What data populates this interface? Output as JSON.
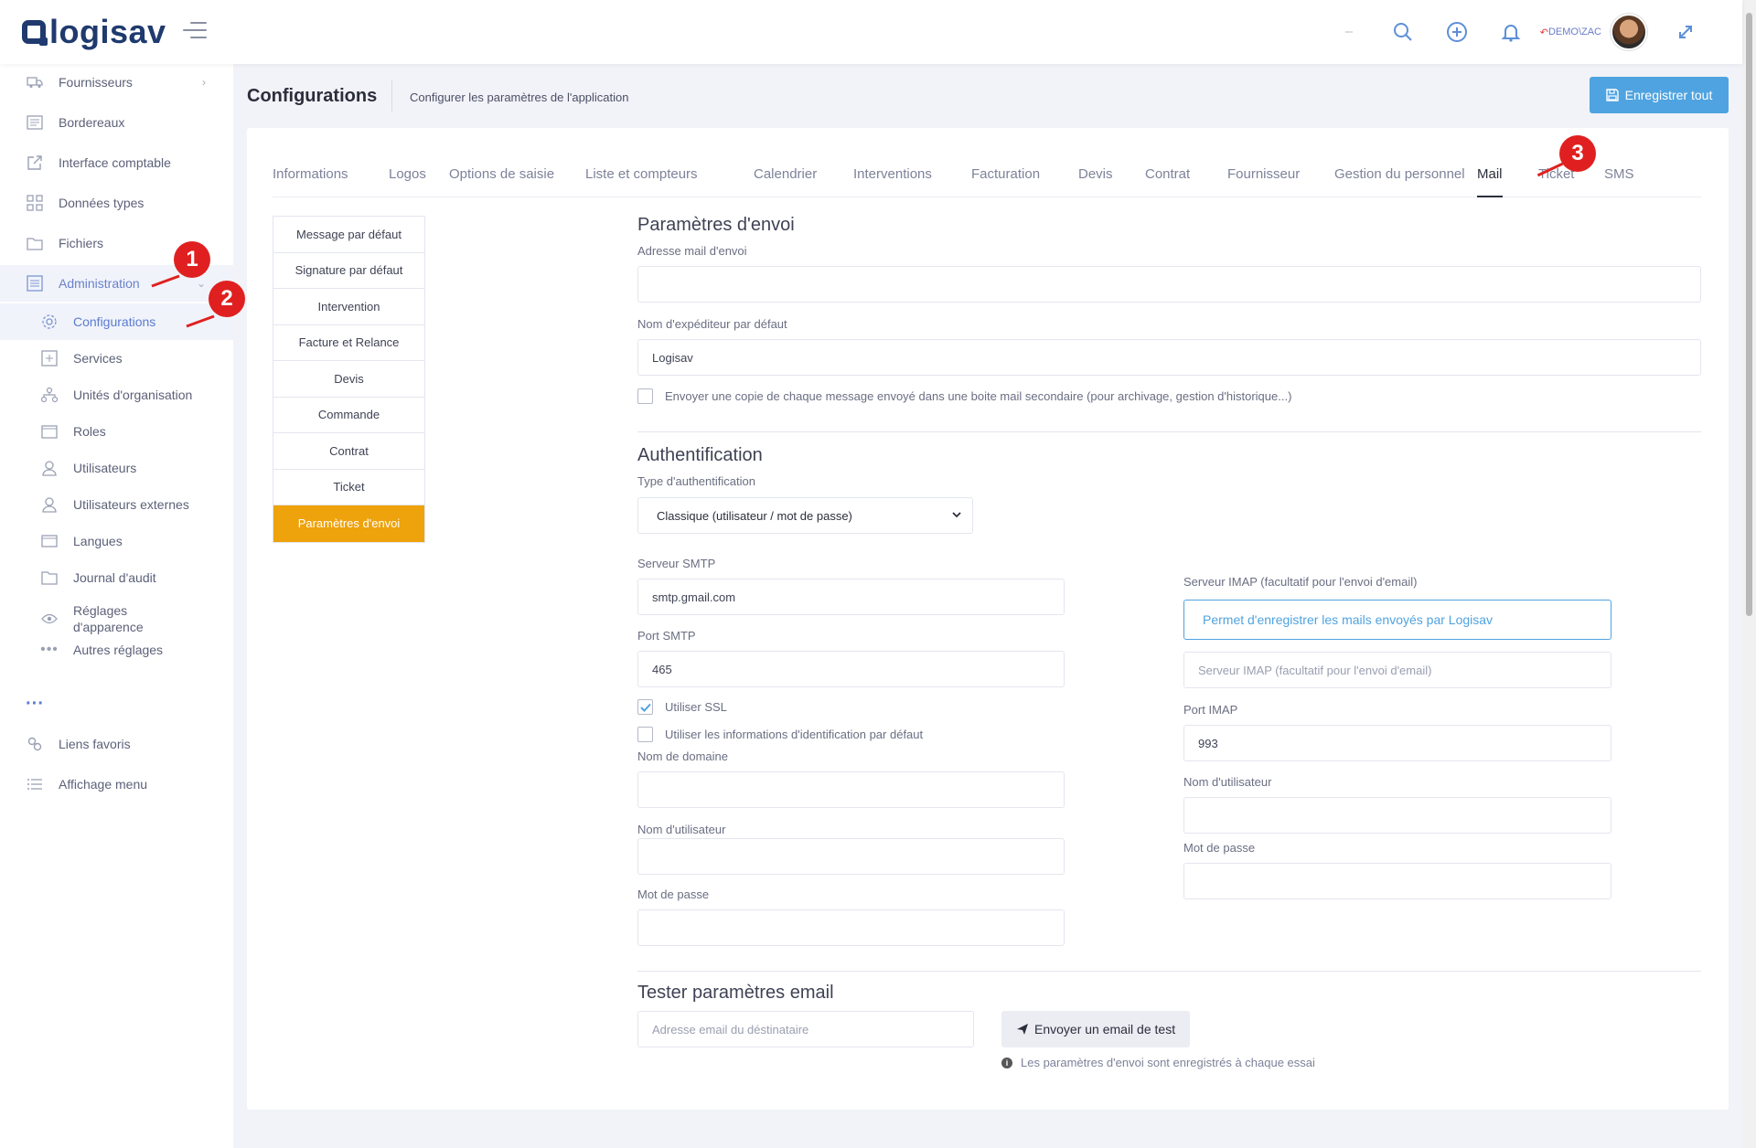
{
  "app": {
    "logo_text": "logisav",
    "user": "DEMO\\ZAC"
  },
  "sidebar": {
    "items": [
      {
        "label": "Fournisseurs",
        "icon": "truck-icon"
      },
      {
        "label": "Bordereaux",
        "icon": "list-icon"
      },
      {
        "label": "Interface comptable",
        "icon": "external-link-icon"
      },
      {
        "label": "Données types",
        "icon": "grid-icon"
      },
      {
        "label": "Fichiers",
        "icon": "folder-icon"
      },
      {
        "label": "Administration",
        "icon": "admin-icon"
      }
    ],
    "sub_items": [
      {
        "label": "Configurations",
        "icon": "gear-icon"
      },
      {
        "label": "Services",
        "icon": "plus-square-icon"
      },
      {
        "label": "Unités d'organisation",
        "icon": "hierarchy-icon"
      },
      {
        "label": "Roles",
        "icon": "window-icon"
      },
      {
        "label": "Utilisateurs",
        "icon": "user-icon"
      },
      {
        "label": "Utilisateurs externes",
        "icon": "user-external-icon"
      },
      {
        "label": "Langues",
        "icon": "language-icon"
      },
      {
        "label": "Journal d'audit",
        "icon": "journal-icon"
      },
      {
        "label": "Réglages d'apparence",
        "icon": "eye-icon"
      },
      {
        "label": "Autres réglages",
        "icon": "dots-icon"
      }
    ],
    "more": "···",
    "bottom_items": [
      {
        "label": "Liens favoris",
        "icon": "link-icon"
      },
      {
        "label": "Affichage menu",
        "icon": "menu-list-icon"
      }
    ]
  },
  "callouts": [
    "1",
    "2",
    "3"
  ],
  "page": {
    "title": "Configurations",
    "subtitle": "Configurer les paramètres de l'application",
    "save_button": "Enregistrer tout"
  },
  "tabs": [
    "Informations",
    "Logos",
    "Options de saisie",
    "Liste et compteurs",
    "Calendrier",
    "Interventions",
    "Facturation",
    "Devis",
    "Contrat",
    "Fournisseur",
    "Gestion du personnel",
    "Mail",
    "Ticket",
    "SMS"
  ],
  "active_tab": "Mail",
  "vmenu": [
    "Message par défaut",
    "Signature par défaut",
    "Intervention",
    "Facture et Relance",
    "Devis",
    "Commande",
    "Contrat",
    "Ticket",
    "Paramètres d'envoi"
  ],
  "form": {
    "envoi": {
      "heading": "Paramètres d'envoi",
      "address_label": "Adresse mail d'envoi",
      "address_value": "",
      "sender_label": "Nom d'expéditeur par défaut",
      "sender_value": "Logisav",
      "copy_checkbox": "Envoyer une copie de chaque message envoyé dans une boite mail secondaire (pour archivage, gestion d'historique...)"
    },
    "auth": {
      "heading": "Authentification",
      "type_label": "Type d'authentification",
      "type_value": "Classique (utilisateur / mot de passe)",
      "smtp_label": "Serveur SMTP",
      "smtp_value": "smtp.gmail.com",
      "port_label": "Port SMTP",
      "port_value": "465",
      "ssl_label": "Utiliser SSL",
      "ssl_checked": true,
      "default_creds_label": "Utiliser les informations d'identification par défaut",
      "domain_label": "Nom de domaine",
      "user_label": "Nom d'utilisateur",
      "password_label": "Mot de passe",
      "imap_label": "Serveur IMAP (facultatif pour l'envoi d'email)",
      "imap_button": "Permet d'enregistrer les mails envoyés par Logisav",
      "imap_placeholder": "Serveur IMAP (facultatif pour l'envoi d'email)",
      "imap_port_label": "Port IMAP",
      "imap_port_value": "993",
      "imap_user_label": "Nom d'utilisateur",
      "imap_password_label": "Mot de passe"
    },
    "test": {
      "heading": "Tester paramètres email",
      "recipient_placeholder": "Adresse email du déstinataire",
      "send_button": "Envoyer un email de test",
      "hint": "Les paramètres d'envoi sont enregistrés à chaque essai"
    }
  },
  "colors": {
    "accent": "#4fa3e0",
    "active_menu": "#eea20b",
    "callout": "#e02020",
    "logo": "#1f3a6e"
  }
}
